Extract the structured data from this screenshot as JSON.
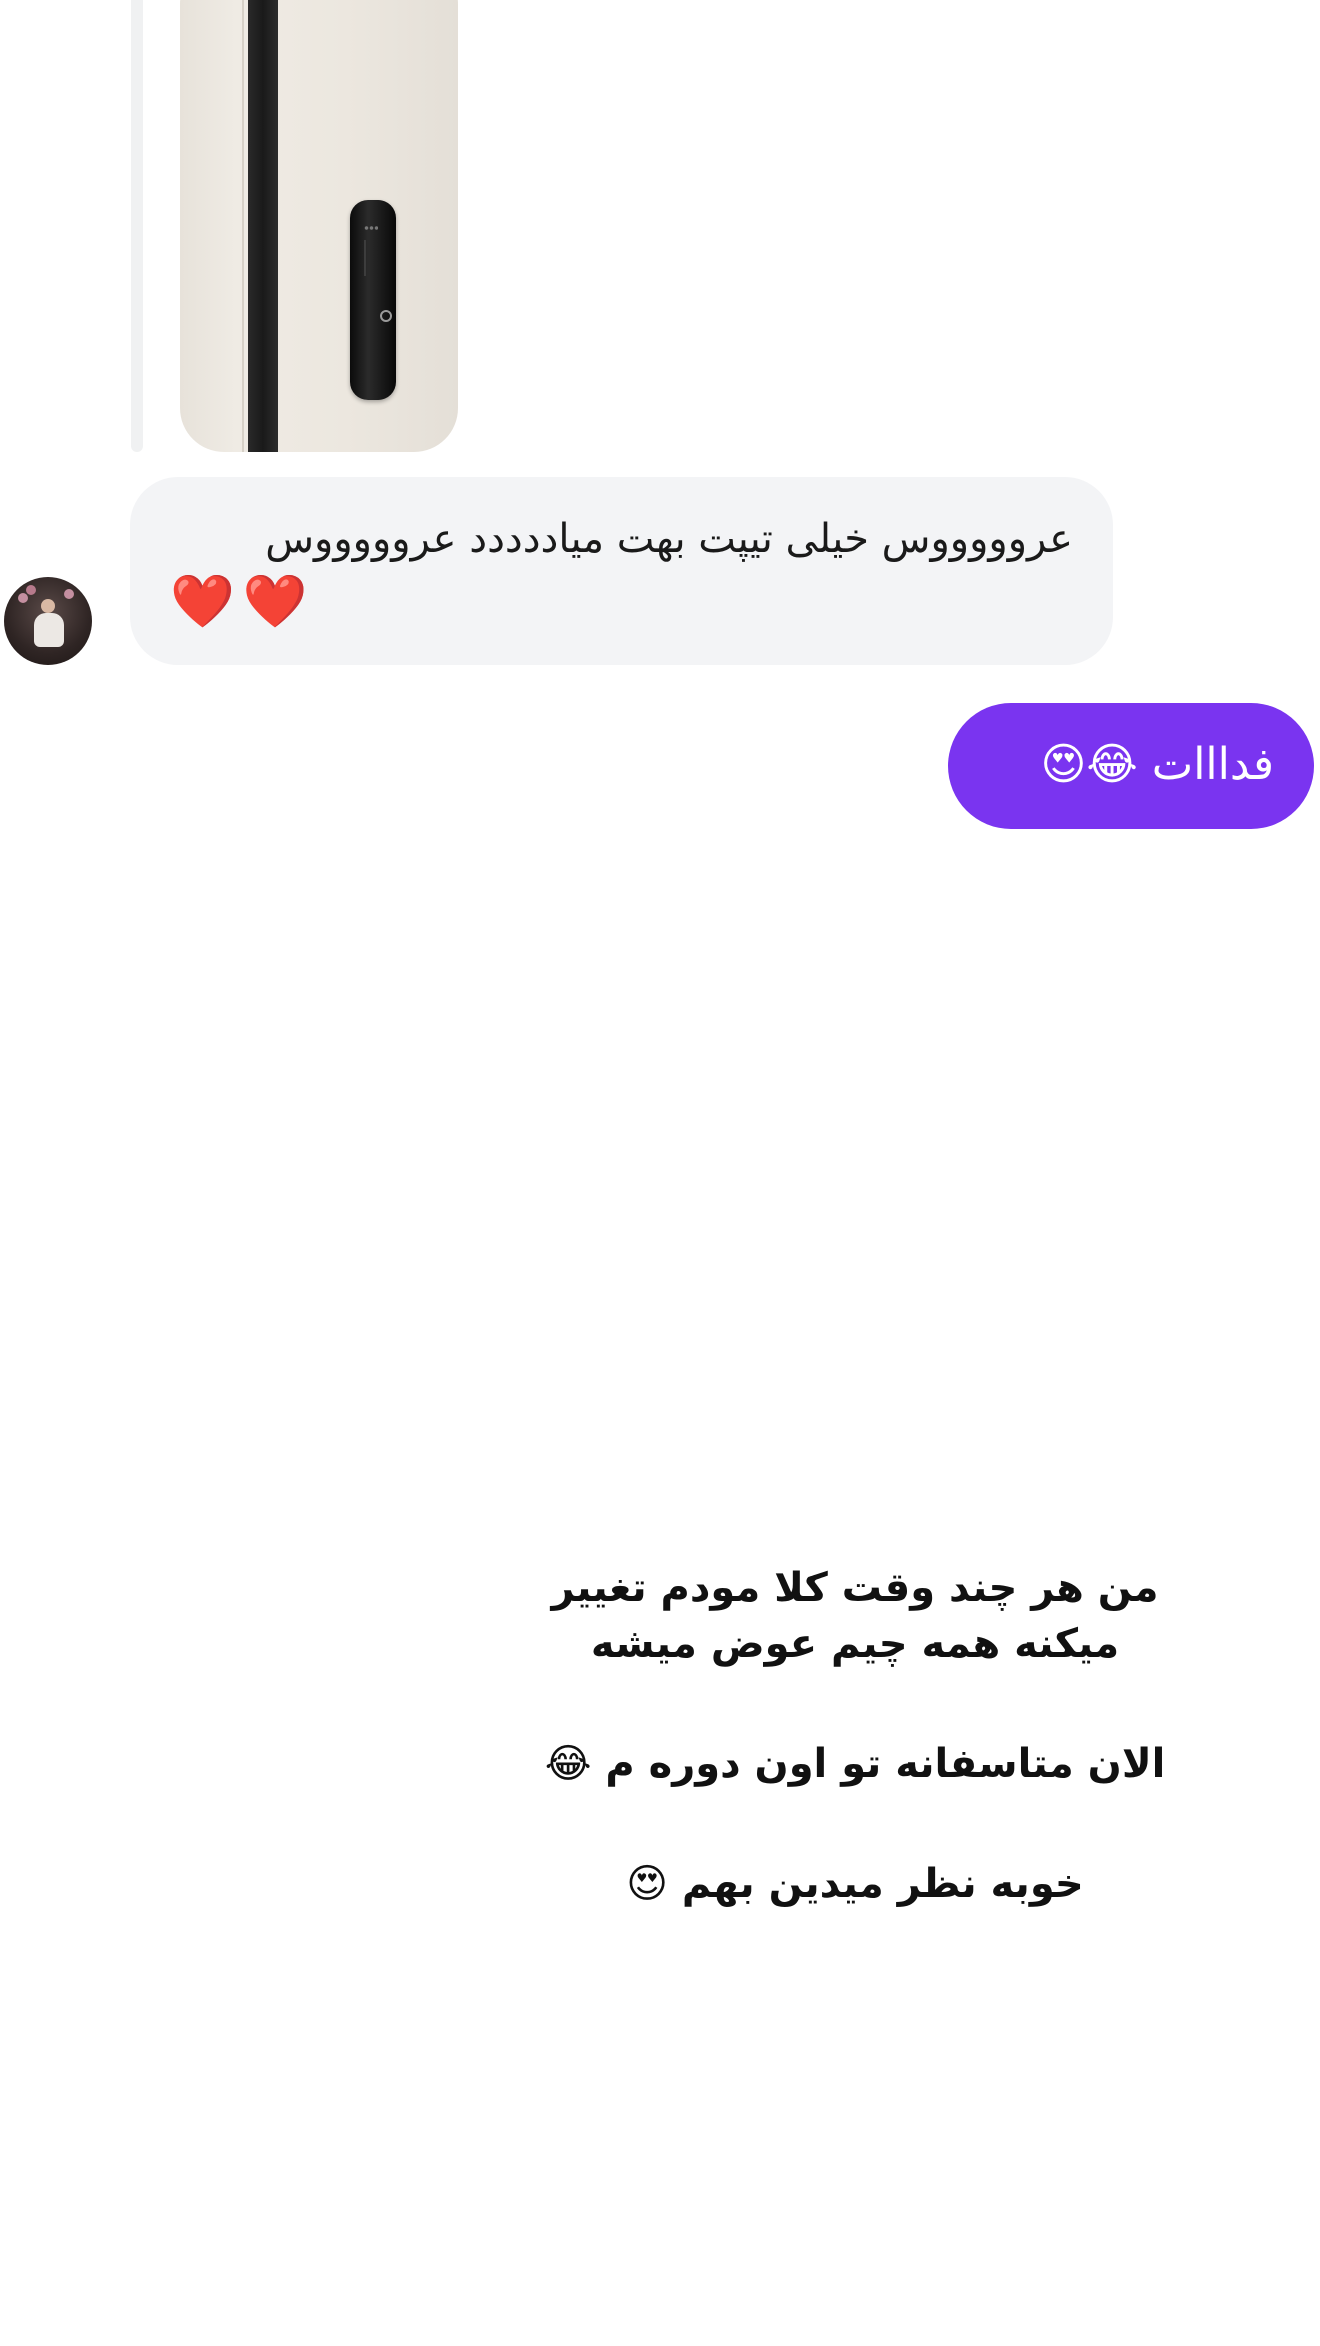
{
  "conversation": {
    "incoming_message": {
      "text": "عروووووس خیلی تیپت بهت میاددددد عروووووس",
      "emoji": "❤️❤️"
    },
    "outgoing_message": {
      "text": "فدااات 😂😍"
    },
    "caption": {
      "line1": "من هر چند وقت کلا مودم  تغییر",
      "line2": "میکنه همه چیم عوض میشه",
      "line3": "الان متاسفانه تو اون دوره م 😂",
      "line4": "خوبه نظر میدین بهم 😍"
    }
  },
  "icons": {
    "avatar": "contact-avatar-photo",
    "shared_image": "door-lock-photo"
  },
  "colors": {
    "incoming_bubble": "#f3f4f6",
    "outgoing_bubble": "#7a34f0",
    "background": "#ffffff"
  }
}
